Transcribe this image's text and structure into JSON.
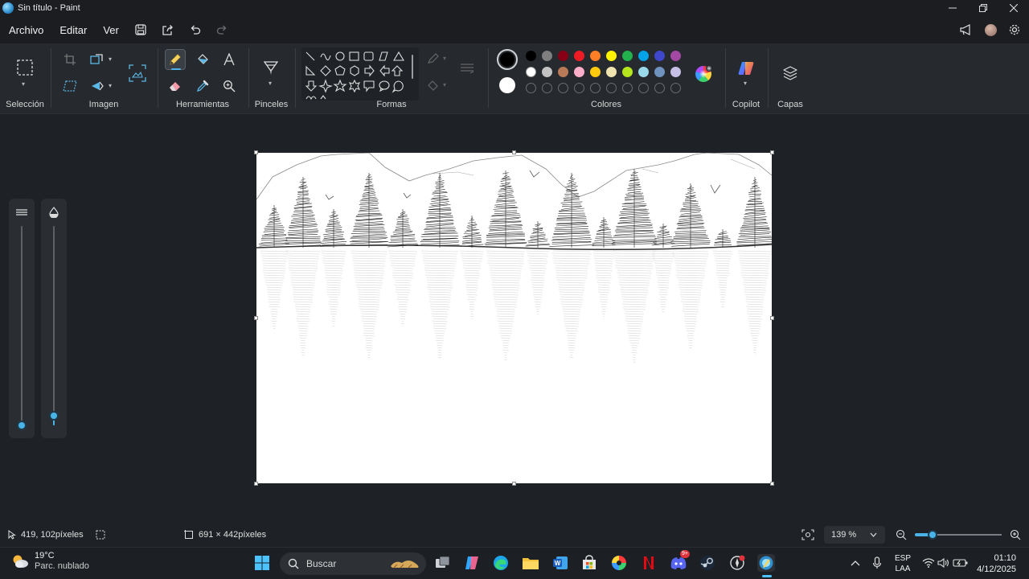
{
  "window": {
    "title": "Sin título - Paint"
  },
  "menu": {
    "items": [
      "Archivo",
      "Editar",
      "Ver"
    ]
  },
  "ribbon": {
    "groups": {
      "selection": "Selección",
      "image": "Imagen",
      "tools": "Herramientas",
      "brushes": "Pinceles",
      "shapes": "Formas",
      "colors": "Colores",
      "copilot": "Copilot",
      "layers": "Capas"
    },
    "active_tool": "pencil",
    "primary_color": "#000000",
    "secondary_color": "#ffffff",
    "palette_row1": [
      "#000000",
      "#7f7f7f",
      "#880015",
      "#ed1c24",
      "#ff7f27",
      "#fff200",
      "#22b14c",
      "#00a2e8",
      "#3f48cc",
      "#a349a4"
    ],
    "palette_row2": [
      "#ffffff",
      "#c3c3c3",
      "#b97a57",
      "#ffaec9",
      "#ffc90e",
      "#efe4b0",
      "#b5e61d",
      "#99d9ea",
      "#7092be",
      "#c8bfe7"
    ]
  },
  "side_sliders": {
    "brush_size_level": 0.0,
    "opacity_level": 0.05
  },
  "status": {
    "cursor_position": "419, 102píxeles",
    "canvas_size": "691 × 442píxeles",
    "zoom": "139 %",
    "zoom_level": 0.2
  },
  "taskbar": {
    "temperature": "19°C",
    "weather": "Parc. nublado",
    "search_placeholder": "Buscar",
    "language_line1": "ESP",
    "language_line2": "LAA",
    "time": "01:10",
    "date": "4/12/2025",
    "discord_badge": "9+"
  }
}
